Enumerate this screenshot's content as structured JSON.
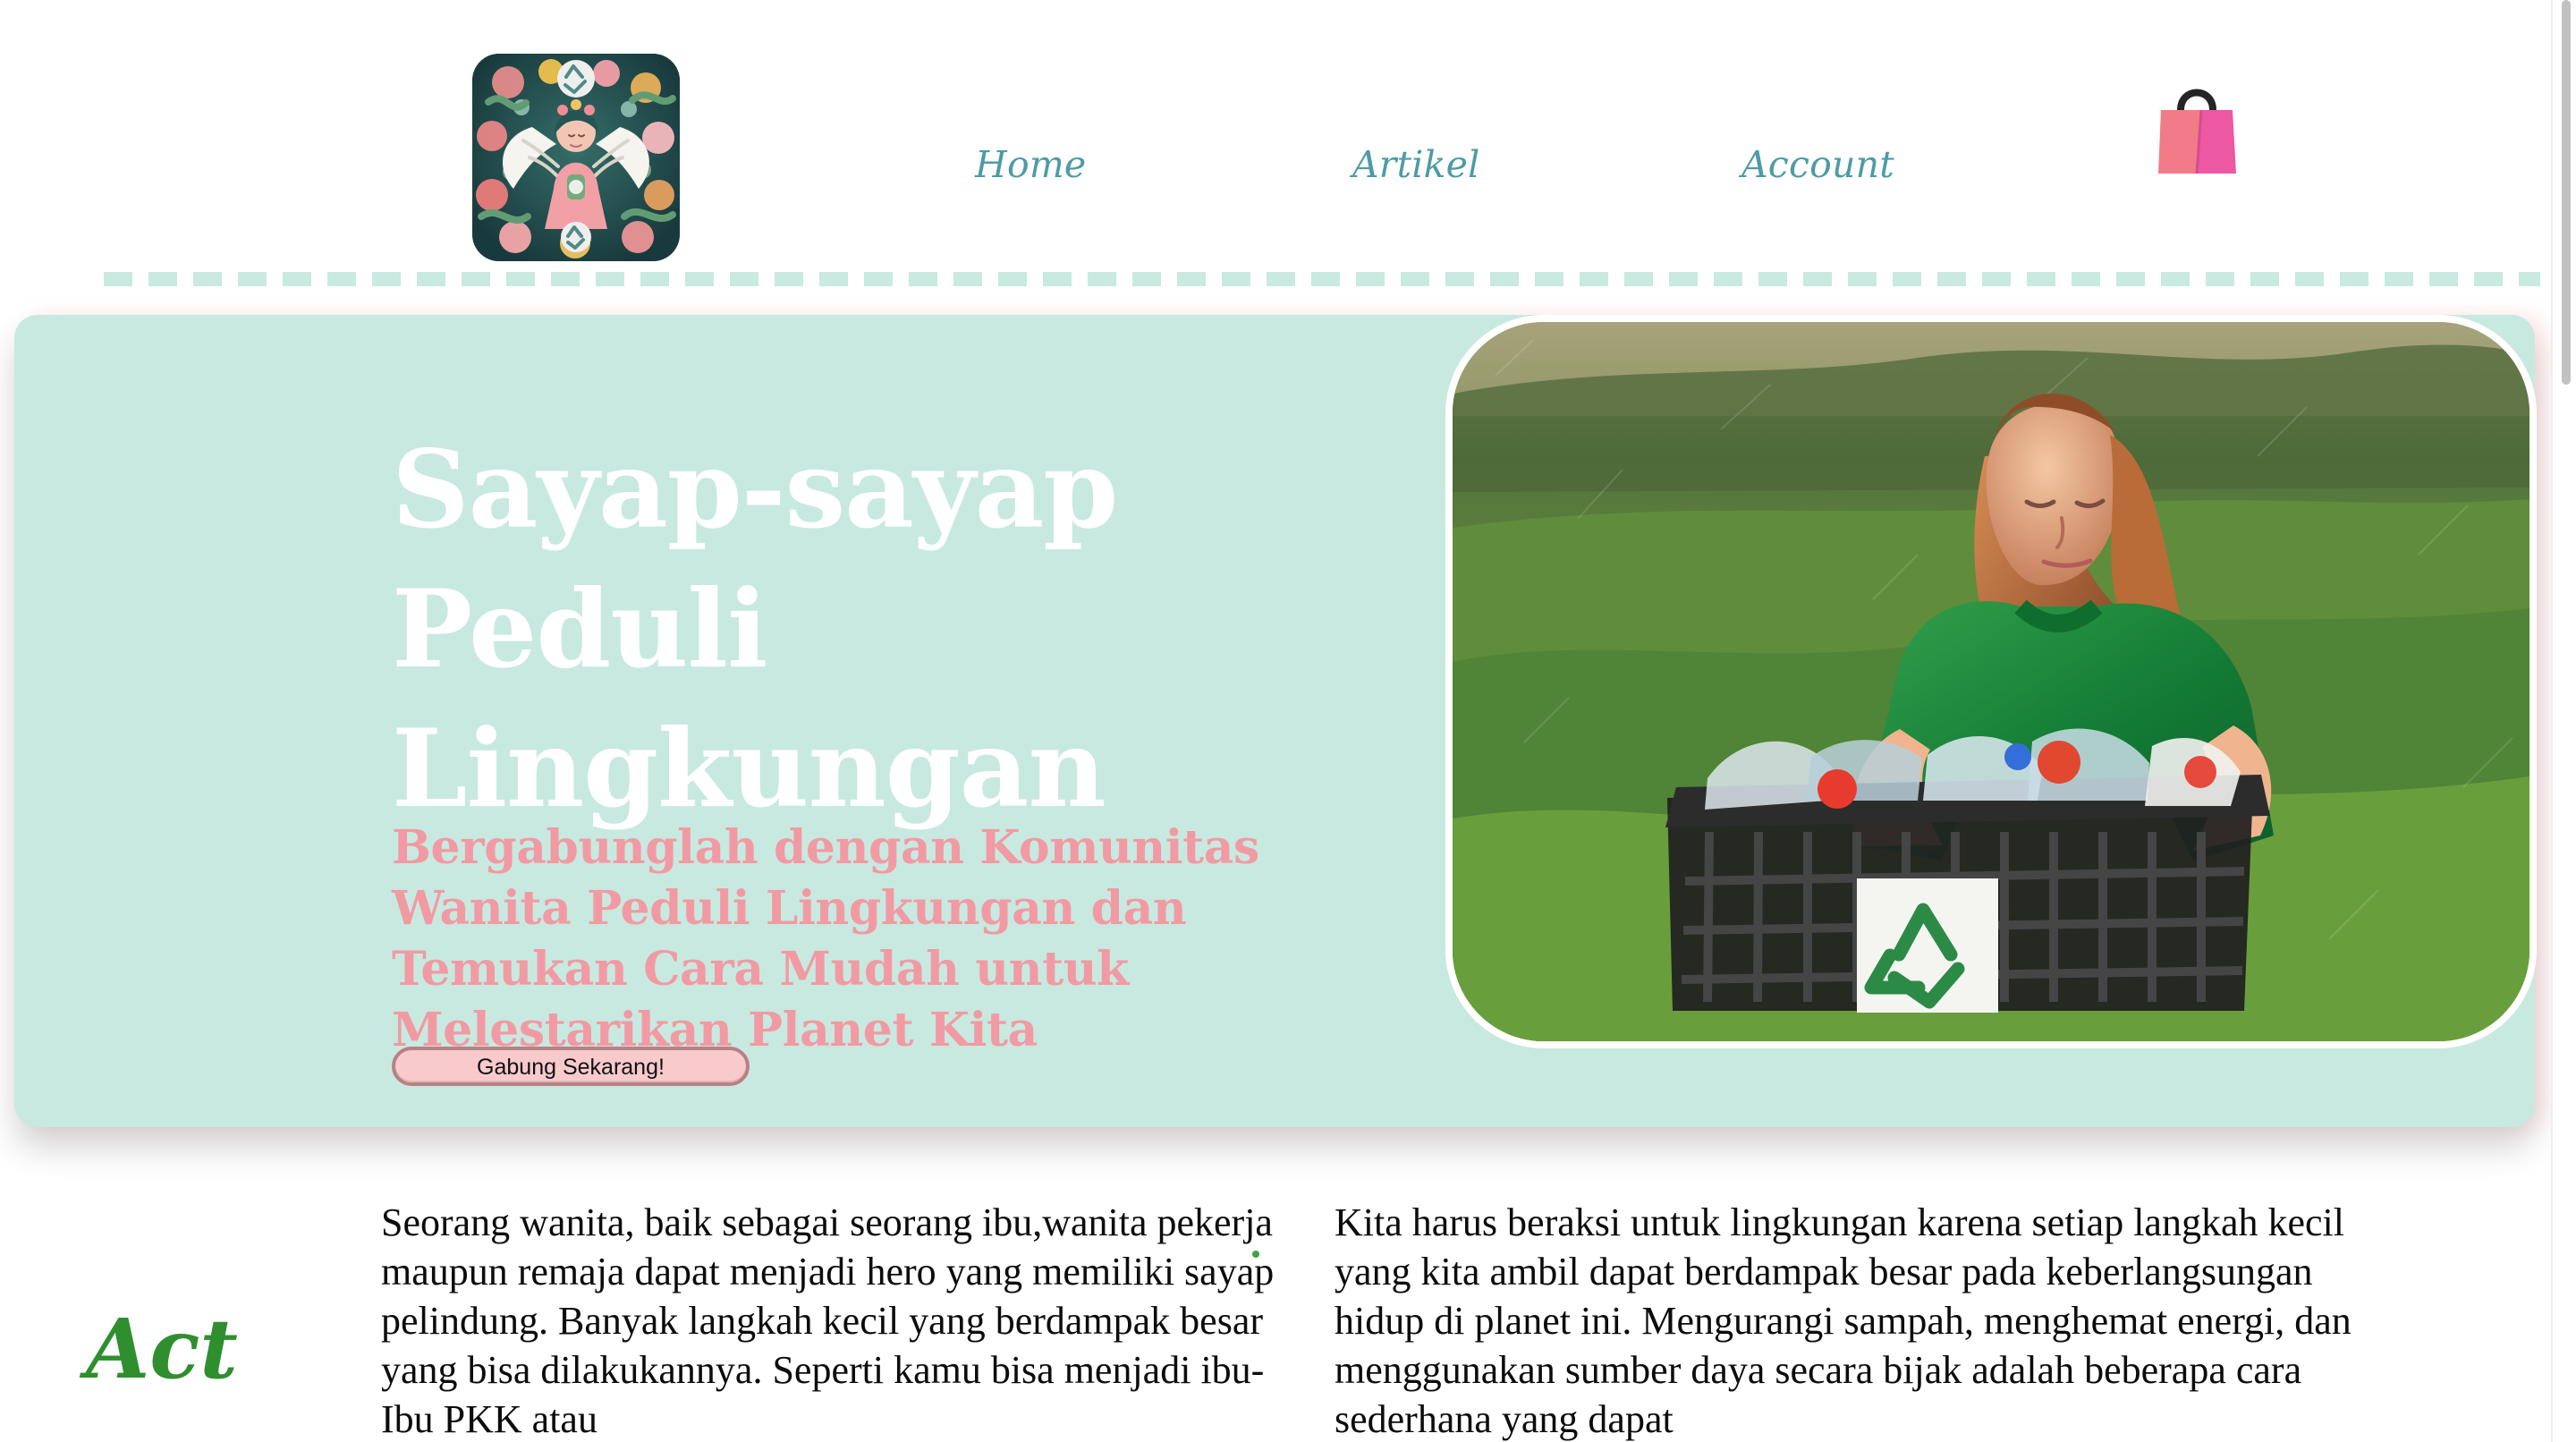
{
  "navigation": {
    "home": "Home",
    "artikel": "Artikel",
    "account": "Account"
  },
  "hero": {
    "title": "Sayap-sayap Peduli Lingkungan",
    "subtitle": "Bergabunglah dengan Komunitas Wanita Peduli Lingkungan dan Temukan Cara Mudah untuk Melestarikan Planet Kita",
    "button_label": "Gabung Sekarang!"
  },
  "article": {
    "act_title": "Act",
    "left_paragraph": "Seorang wanita, baik sebagai seorang ibu,wanita pekerja maupun remaja dapat menjadi hero yang memiliki sayap pelindung. Banyak langkah kecil yang berdampak besar yang bisa dilakukannya. Seperti kamu bisa menjadi ibu-Ibu PKK atau",
    "right_paragraph": "Kita harus beraksi untuk lingkungan karena setiap langkah kecil yang kita ambil dapat berdampak besar pada keberlangsungan hidup di planet ini. Mengurangi sampah, menghemat energi, dan menggunakan sumber daya secara bijak adalah beberapa cara sederhana yang dapat"
  },
  "colors": {
    "nav_text": "#4d9ba7",
    "hero_background": "#c8e9e0",
    "hero_title": "#ffffff",
    "hero_subtitle": "#f29aa3",
    "button_background": "#f8cacc",
    "act_title": "#2f8f2e"
  },
  "icons": {
    "logo": "winged-environmental-woman-logo",
    "cart": "shopping-bag-icon"
  }
}
